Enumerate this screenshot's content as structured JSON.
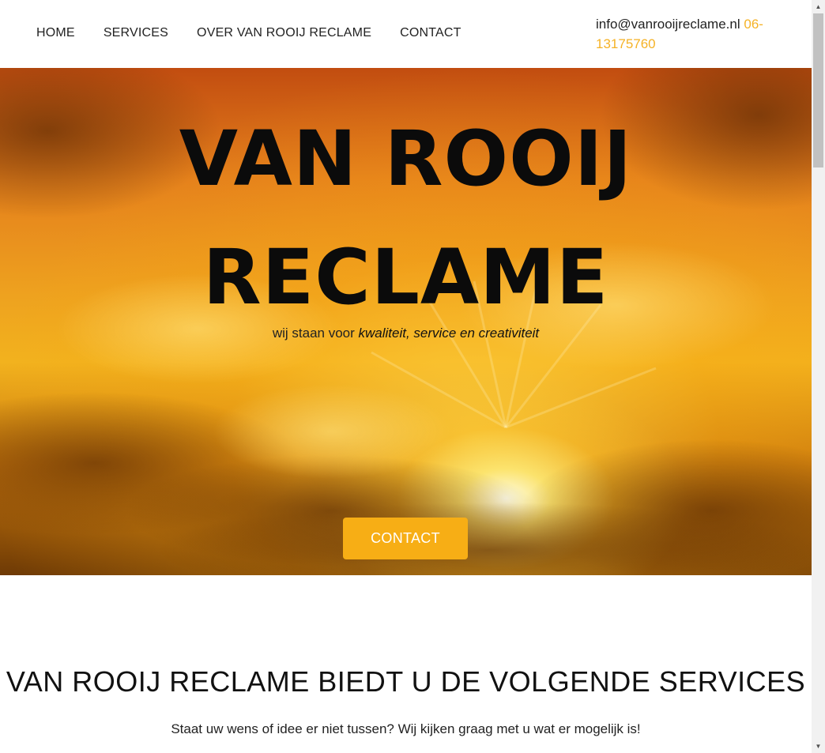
{
  "nav": {
    "items": [
      "HOME",
      "SERVICES",
      "OVER VAN ROOIJ RECLAME",
      "CONTACT"
    ]
  },
  "contact": {
    "email": "info@vanrooijreclame.nl",
    "phone": "06-13175760"
  },
  "hero": {
    "title_line1": "VAN ROOIJ",
    "title_line2": "RECLAME",
    "subtitle_prefix": "wij staan voor ",
    "subtitle_emphasis": "kwaliteit, service en creativiteit",
    "button_label": "CONTACT"
  },
  "services": {
    "title": "VAN ROOIJ RECLAME BIEDT U DE VOLGENDE SERVICES",
    "subtitle": "Staat uw wens of idee er niet tussen? Wij kijken graag met u wat er mogelijk is!"
  },
  "colors": {
    "accent": "#f7ae15",
    "phone": "#f5b226",
    "text": "#111111"
  },
  "icons": {
    "scroll_up": "triangle-up",
    "scroll_down": "triangle-down"
  }
}
